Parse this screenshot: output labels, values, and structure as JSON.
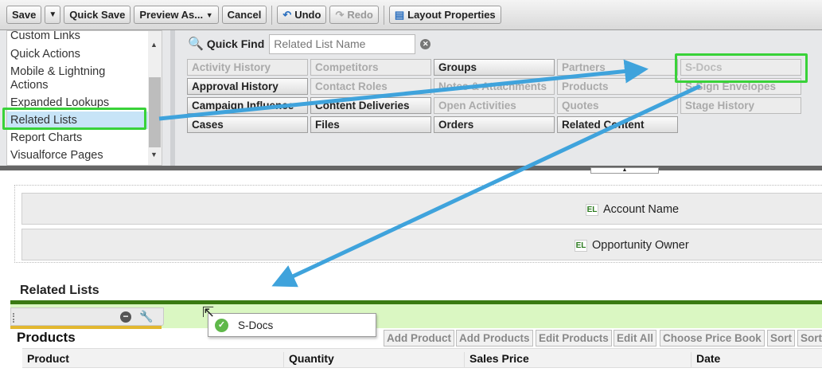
{
  "toolbar": {
    "save": "Save",
    "quick_save": "Quick Save",
    "preview_as": "Preview As...",
    "cancel": "Cancel",
    "undo": "Undo",
    "redo": "Redo",
    "layout_properties": "Layout Properties"
  },
  "sidebar": {
    "items": [
      "Custom Links",
      "Quick Actions",
      "Mobile & Lightning Actions",
      "Expanded Lookups",
      "Related Lists",
      "Report Charts",
      "Visualforce Pages"
    ],
    "selected": "Related Lists"
  },
  "quick_find": {
    "label": "Quick Find",
    "placeholder": "Related List Name"
  },
  "palette_items": {
    "col1": [
      "Activity History",
      "Approval History",
      "Campaign Influence",
      "Cases"
    ],
    "col2": [
      "Competitors",
      "Contact Roles",
      "Content Deliveries",
      "Files"
    ],
    "col3": [
      "Groups",
      "Notes & Attachments",
      "Open Activities",
      "Orders"
    ],
    "col4": [
      "Partners",
      "Products",
      "Quotes",
      "Related Content"
    ],
    "col5": [
      "S-Docs",
      "S-Sign Envelopes",
      "Stage History"
    ]
  },
  "fields": {
    "account_name": "Account Name",
    "opportunity_owner": "Opportunity Owner",
    "el_badge": "EL"
  },
  "related_lists": {
    "title": "Related Lists",
    "dragging": "S-Docs",
    "products_title": "Products",
    "buttons": [
      "Add Product",
      "Add Products",
      "Edit Products",
      "Edit All",
      "Choose Price Book",
      "Sort",
      "Sort"
    ],
    "columns": [
      "Product",
      "Quantity",
      "Sales Price",
      "Date"
    ]
  },
  "colors": {
    "highlight": "#39d239",
    "arrow": "#3fa3dc",
    "section_bar": "#3a7a12",
    "drop_zone": "#daf7c2"
  }
}
